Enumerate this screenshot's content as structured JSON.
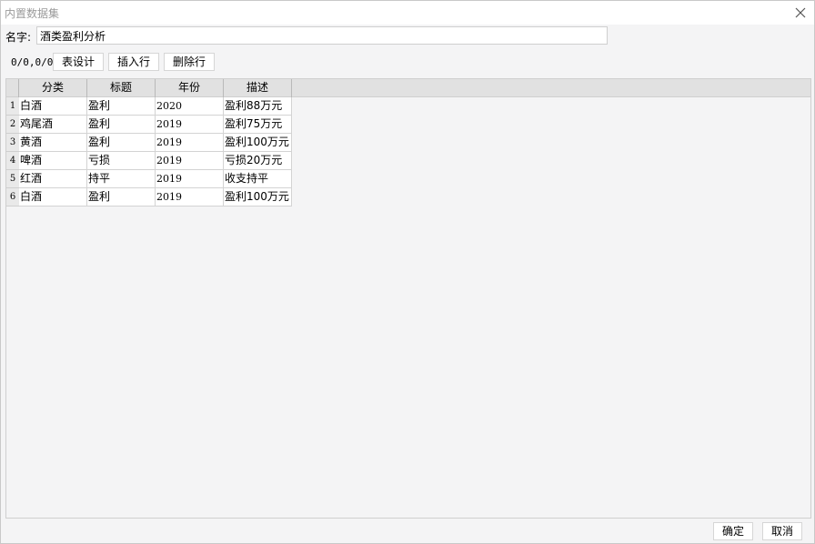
{
  "window": {
    "title": "内置数据集"
  },
  "name_field": {
    "label": "名字:",
    "value": "酒类盈利分析"
  },
  "toolbar": {
    "cursor_position": "0/0,0/0",
    "table_design_label": "表设计",
    "insert_row_label": "插入行",
    "delete_row_label": "删除行"
  },
  "table": {
    "columns": [
      "分类",
      "标题",
      "年份",
      "描述"
    ],
    "rows": [
      {
        "num": "1",
        "cells": [
          "白酒",
          "盈利",
          "2020",
          "盈利88万元"
        ]
      },
      {
        "num": "2",
        "cells": [
          "鸡尾酒",
          "盈利",
          "2019",
          "盈利75万元"
        ]
      },
      {
        "num": "3",
        "cells": [
          "黄酒",
          "盈利",
          "2019",
          "盈利100万元"
        ]
      },
      {
        "num": "4",
        "cells": [
          "啤酒",
          "亏损",
          "2019",
          "亏损20万元"
        ]
      },
      {
        "num": "5",
        "cells": [
          "红酒",
          "持平",
          "2019",
          "收支持平"
        ]
      },
      {
        "num": "6",
        "cells": [
          "白酒",
          "盈利",
          "2019",
          "盈利100万元"
        ]
      }
    ]
  },
  "footer": {
    "confirm_label": "确定",
    "cancel_label": "取消"
  }
}
